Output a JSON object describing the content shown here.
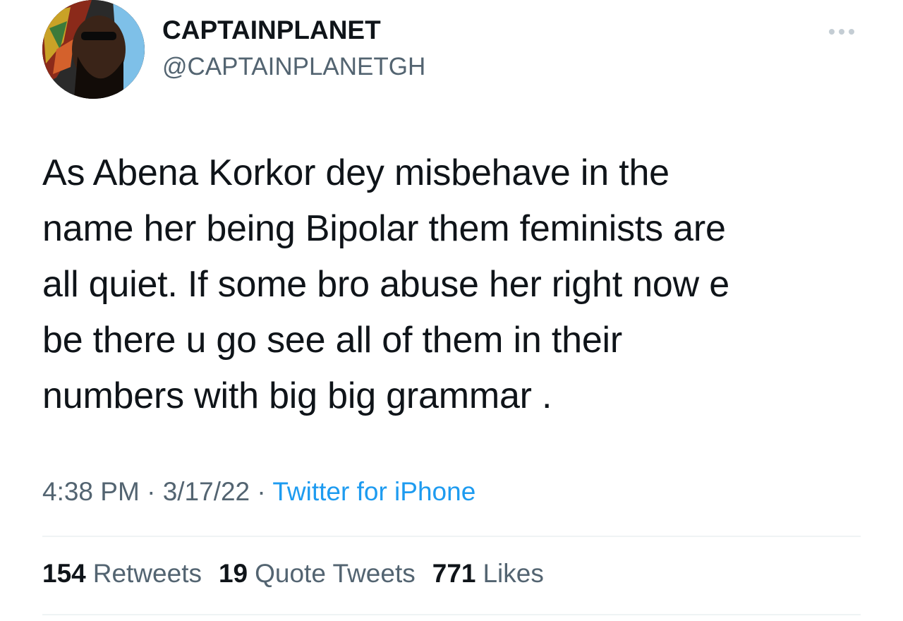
{
  "author": {
    "display_name": "CAPTAINPLANET",
    "handle": "@CAPTAINPLANETGH"
  },
  "tweet": {
    "text": "As Abena Korkor dey misbehave in the\nname her being Bipolar them feminists are\nall quiet. If some bro abuse her right now e\nbe there u go see all of them in their\nnumbers with big big grammar .",
    "time": "4:38 PM",
    "date": "3/17/22",
    "separator": "·",
    "source": "Twitter for iPhone"
  },
  "stats": {
    "retweets": {
      "count": "154",
      "label": "Retweets"
    },
    "quotes": {
      "count": "19",
      "label": "Quote Tweets"
    },
    "likes": {
      "count": "771",
      "label": "Likes"
    }
  },
  "icons": {
    "more": "more-horizontal-icon",
    "avatar": "profile-avatar"
  },
  "colors": {
    "text": "#0f1419",
    "secondary": "#536471",
    "accent": "#1d9bf0",
    "divider": "#eff3f4"
  }
}
